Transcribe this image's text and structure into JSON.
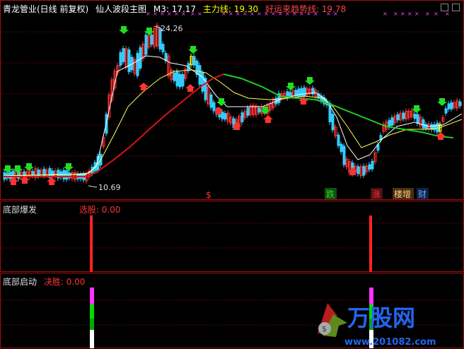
{
  "main_panel": {
    "title": "青龙管业(日线 前复权)",
    "indicator_name": "仙人波段主图",
    "m3": "M3: 17.17",
    "main_line": "主力线: 19.30",
    "trend_line": "好运来趋势线: 19.78",
    "high_label": "24.26",
    "low_label": "10.69",
    "events": [
      {
        "text": "$"
      },
      {
        "text": "跌"
      },
      {
        "text": "涨"
      },
      {
        "text": "楼增"
      },
      {
        "text": "财"
      }
    ]
  },
  "panel2": {
    "title": "底部爆发",
    "value": "选股: 0.00"
  },
  "panel3": {
    "title": "底部启动",
    "value": "决胜: 0.00"
  },
  "watermark": {
    "brand": "万股网",
    "url": "www.201082.com"
  },
  "colors": {
    "bar_red": "#ff3333",
    "bar_cyan": "#33ccff",
    "bar_yellow": "#ffff00",
    "ma_white": "#ffffff",
    "ma_yellow": "#ffff55",
    "ma_red": "#dd1111",
    "ma_green": "#22cc22"
  }
}
